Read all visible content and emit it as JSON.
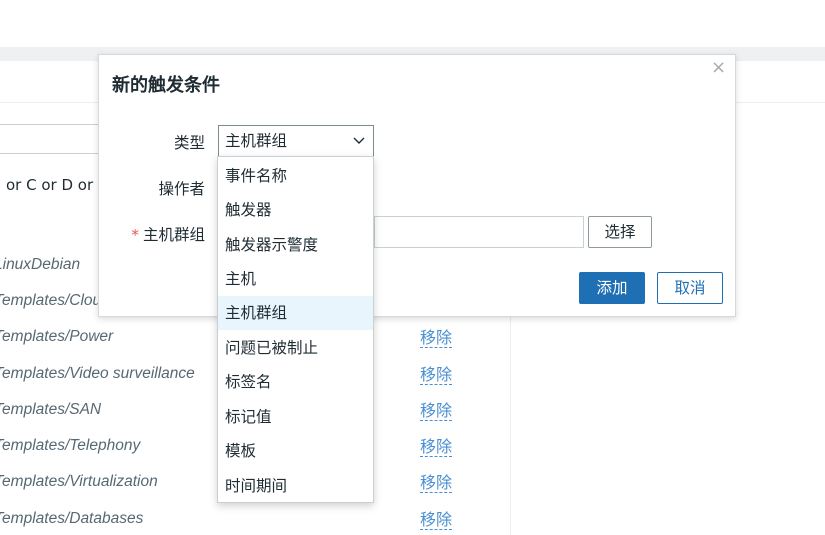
{
  "background": {
    "filter_hint": "or C or D or E",
    "rows": [
      {
        "name": "LinuxDebian",
        "remove": ""
      },
      {
        "name": "Templates/Cloud",
        "remove": ""
      },
      {
        "name": "Templates/Power",
        "remove": "移除"
      },
      {
        "name": "Templates/Video surveillance",
        "remove": "移除"
      },
      {
        "name": "Templates/SAN",
        "remove": "移除"
      },
      {
        "name": "Templates/Telephony",
        "remove": "移除"
      },
      {
        "name": "Templates/Virtualization",
        "remove": "移除"
      },
      {
        "name": "Templates/Databases",
        "remove": "移除"
      }
    ]
  },
  "dialog": {
    "title": "新的触发条件",
    "close_glyph": "×",
    "type_label": "类型",
    "operator_label": "操作者",
    "host_group_label": "主机群组",
    "required_mark": "*",
    "type_selected": "主机群组",
    "select_button": "选择",
    "add_button": "添加",
    "cancel_button": "取消"
  },
  "dropdown": {
    "options": [
      "事件名称",
      "触发器",
      "触发器示警度",
      "主机",
      "主机群组",
      "问题已被制止",
      "标签名",
      "标记值",
      "模板",
      "时间期间"
    ],
    "selected_index": 4
  },
  "colors": {
    "primary": "#1f6fb5",
    "link": "#4a8fd2",
    "selected_option_bg": "#e8f5fc",
    "required": "#e45959"
  }
}
